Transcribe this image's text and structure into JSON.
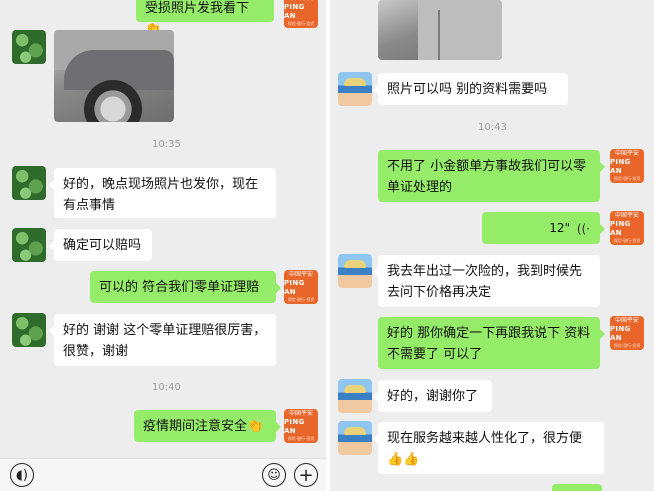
{
  "left": {
    "messages": {
      "m0": "受损照片发我看下👏",
      "t1": "10:35",
      "m2": "好的，晚点现场照片也发你，现在有点事情",
      "m3": "确定可以赔吗",
      "m4": "可以的  符合我们零单证理赔",
      "m5": "好的 谢谢  这个零单证理赔很厉害，很赞，谢谢",
      "t2": "10:40",
      "m6": "疫情期间注意安全👏"
    },
    "insurer_avatar": {
      "line1": "中国平安",
      "line2": "PING AN",
      "line3": "保险·银行·投资"
    }
  },
  "right": {
    "messages": {
      "m1": "照片可以吗  别的资料需要吗",
      "t1": "10:43",
      "m2": "不用了  小金额单方事故我们可以零单证处理的",
      "m3_voice": "12\"",
      "m4": "我去年出过一次险的，我到时候先去问下价格再决定",
      "m5": "好的  那你确定一下再跟我说下  资料不需要了  可以了",
      "m6": "好的，谢谢你了",
      "m7": "现在服务越来越人性化了，很方便👍👍"
    }
  },
  "colors": {
    "background": "#ededed",
    "incoming": "#ffffff",
    "outgoing": "#95ec69",
    "insurer_orange": "#e8662a"
  },
  "icons": {
    "voice": "voice-icon",
    "emoji": "emoji-icon",
    "add": "add-icon"
  }
}
